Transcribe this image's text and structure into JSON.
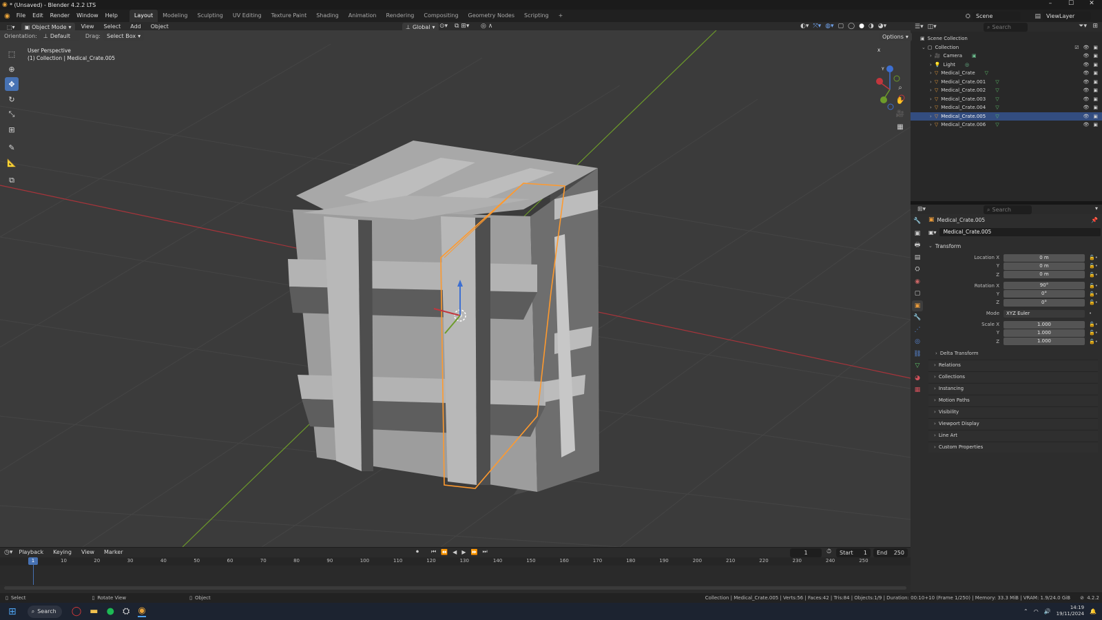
{
  "window": {
    "title": "* (Unsaved) - Blender 4.2.2 LTS",
    "controls": [
      "–",
      "☐",
      "✕"
    ]
  },
  "menu": {
    "items": [
      "File",
      "Edit",
      "Render",
      "Window",
      "Help"
    ],
    "workspaces": [
      "Layout",
      "Modeling",
      "Sculpting",
      "UV Editing",
      "Texture Paint",
      "Shading",
      "Animation",
      "Rendering",
      "Compositing",
      "Geometry Nodes",
      "Scripting"
    ],
    "active_workspace": "Layout",
    "add_tab": "+",
    "scene": "Scene",
    "view_layer": "ViewLayer"
  },
  "viewport_header": {
    "mode": "Object Mode",
    "menus": [
      "View",
      "Select",
      "Add",
      "Object"
    ],
    "transform_orientation": "Global",
    "orientation_label": "Orientation:",
    "orientation_value": "Default",
    "drag_label": "Drag:",
    "drag_value": "Select Box",
    "options": "Options"
  },
  "viewport": {
    "perspective": "User Perspective",
    "context": "(1) Collection | Medical_Crate.005",
    "gizmo_labels": {
      "x": "X",
      "y": "Y",
      "z": "Z"
    }
  },
  "outliner": {
    "search_placeholder": "Search",
    "scene_collection": "Scene Collection",
    "collection": "Collection",
    "items": [
      {
        "name": "Camera",
        "type": "camera",
        "selected": false
      },
      {
        "name": "Light",
        "type": "light",
        "selected": false
      },
      {
        "name": "Medical_Crate",
        "type": "mesh",
        "selected": false
      },
      {
        "name": "Medical_Crate.001",
        "type": "mesh",
        "selected": false
      },
      {
        "name": "Medical_Crate.002",
        "type": "mesh",
        "selected": false
      },
      {
        "name": "Medical_Crate.003",
        "type": "mesh",
        "selected": false
      },
      {
        "name": "Medical_Crate.004",
        "type": "mesh",
        "selected": false
      },
      {
        "name": "Medical_Crate.005",
        "type": "mesh",
        "selected": true
      },
      {
        "name": "Medical_Crate.006",
        "type": "mesh",
        "selected": false
      }
    ]
  },
  "properties": {
    "search_placeholder": "Search",
    "object_title": "Medical_Crate.005",
    "object_name": "Medical_Crate.005",
    "transform_panel": "Transform",
    "location_label": "Location X",
    "location": {
      "x": "0 m",
      "y": "0 m",
      "z": "0 m"
    },
    "rotation_label": "Rotation X",
    "rotation": {
      "x": "90°",
      "y": "0°",
      "z": "0°"
    },
    "mode_label": "Mode",
    "mode_value": "XYZ Euler",
    "scale_label": "Scale X",
    "scale": {
      "x": "1.000",
      "y": "1.000",
      "z": "1.000"
    },
    "axis_y": "Y",
    "axis_z": "Z",
    "delta_transform": "Delta Transform",
    "panels": [
      "Relations",
      "Collections",
      "Instancing",
      "Motion Paths",
      "Visibility",
      "Viewport Display",
      "Line Art",
      "Custom Properties"
    ]
  },
  "timeline": {
    "menus": [
      "Playback",
      "Keying",
      "View",
      "Marker"
    ],
    "current_frame": "1",
    "start_label": "Start",
    "start": "1",
    "end_label": "End",
    "end": "250",
    "ruler": [
      "10",
      "20",
      "30",
      "40",
      "50",
      "60",
      "70",
      "80",
      "90",
      "100",
      "110",
      "120",
      "130",
      "140",
      "150",
      "160",
      "170",
      "180",
      "190",
      "200",
      "210",
      "220",
      "230",
      "240",
      "250"
    ],
    "playhead": "1"
  },
  "statusbar": {
    "select": "Select",
    "rotate": "Rotate View",
    "object": "Object",
    "stats": "Collection | Medical_Crate.005 | Verts:56 | Faces:42 | Tris:84 | Objects:1/9 | Duration: 00:10+10 (Frame 1/250) | Memory: 33.3 MiB | VRAM: 1.9/24.0 GiB",
    "version": "4.2.2"
  },
  "taskbar": {
    "search": "Search",
    "time": "14:19",
    "date": "19/11/2024"
  },
  "colors": {
    "accent": "#4772b3",
    "selection": "#ff9a2e",
    "x_axis": "#c2363d",
    "y_axis": "#6d9b2a",
    "z_axis": "#3d6fd1"
  }
}
